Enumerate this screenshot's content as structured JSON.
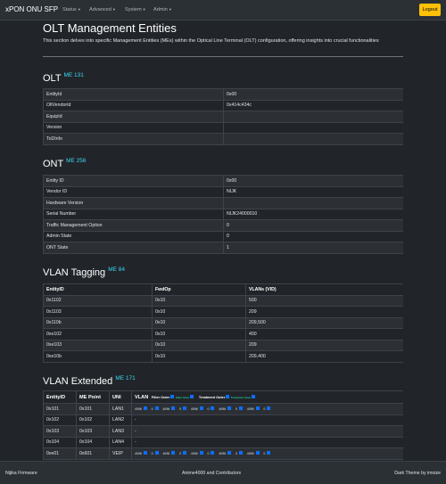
{
  "navbar": {
    "brand": "xPON ONU SFP",
    "items": [
      "Status",
      "Advanced",
      "System",
      "Admin"
    ],
    "logout": "Logout"
  },
  "page": {
    "title": "OLT Management Entities",
    "intro": "This section delves into specific Management Entities (MEs) within the Optical Line Terminal (OLT) configuration, offering insights into crucial functionalities"
  },
  "olt": {
    "title": "OLT",
    "me": "ME 131",
    "rows": [
      [
        "EntityId",
        "0x00"
      ],
      [
        "OltVendorId",
        "0x414c434c"
      ],
      [
        "EquipId",
        ""
      ],
      [
        "Version",
        ""
      ],
      [
        "ToDInfo",
        ""
      ]
    ]
  },
  "ont": {
    "title": "ONT",
    "me": "ME 256",
    "rows": [
      [
        "Entity ID",
        "0x00"
      ],
      [
        "Vendor ID",
        "NIJK"
      ],
      [
        "Hardware Version",
        ""
      ],
      [
        "Serial Number",
        "NIJK24000010"
      ],
      [
        "Traffic Management Option",
        "0"
      ],
      [
        "Admin State",
        "0"
      ],
      [
        "ONT State",
        "1"
      ]
    ]
  },
  "vlan_tagging": {
    "title": "VLAN Tagging",
    "me": "ME 84",
    "headers": [
      "EntityID",
      "FwdOp",
      "VLANs (VID)"
    ],
    "rows": [
      [
        "0x1102",
        "0x10",
        "500"
      ],
      [
        "0x1103",
        "0x10",
        "209"
      ],
      [
        "0x110b",
        "0x10",
        "209,500"
      ],
      [
        "0xe102",
        "0x10",
        "400"
      ],
      [
        "0xe103",
        "0x10",
        "209"
      ],
      [
        "0xe10b",
        "0x10",
        "209,400"
      ]
    ]
  },
  "vlan_extended": {
    "title": "VLAN Extended",
    "me": "ME 171",
    "headers": [
      "EntityID",
      "ME Point",
      "UNI",
      "VLAN"
    ],
    "vlan_header": {
      "filter": "Filter Outer",
      "filter_sub": "Filter Inner",
      "treatment": "Treatment Outer",
      "treatment_sub": "Treatment Inner"
    },
    "rows": [
      [
        "0x101",
        "0x101",
        "LAN1",
        ""
      ],
      [
        "0x102",
        "0x102",
        "LAN2",
        "-"
      ],
      [
        "0x103",
        "0x103",
        "LAN3",
        "-"
      ],
      [
        "0x104",
        "0x104",
        "LAN4",
        "-"
      ],
      [
        "0xe01",
        "0x601",
        "VEIP",
        ""
      ]
    ],
    "vlan_values": [
      "4096",
      "0",
      "4096",
      "0",
      "4096",
      "0",
      "4096",
      "0",
      "4096",
      "0"
    ]
  },
  "footer": {
    "left": "Nijika Firmware",
    "center": "Anime4000 and Contributors",
    "right": "Dark Theme by imoize"
  },
  "colors": {
    "background": "#212529",
    "accent": "#3dd5f3",
    "logout": "#ffc107",
    "value_marker": "#0d6efd"
  }
}
